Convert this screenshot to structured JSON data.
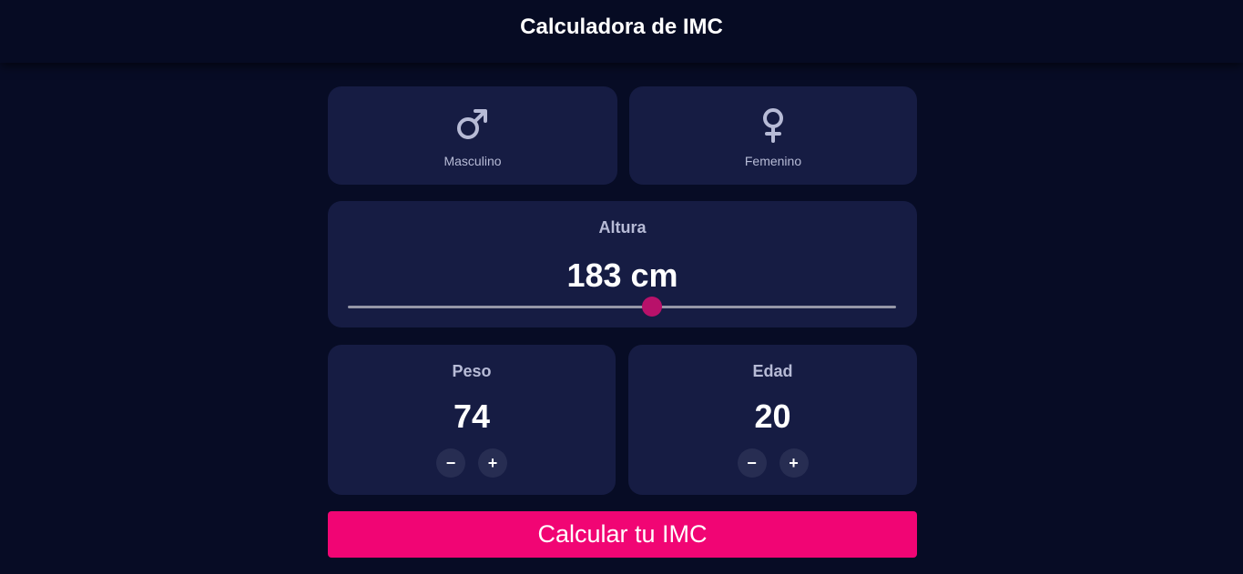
{
  "header": {
    "title": "Calculadora de IMC"
  },
  "gender": {
    "male": {
      "label": "Masculino",
      "icon": "male-symbol-icon"
    },
    "female": {
      "label": "Femenino",
      "icon": "female-symbol-icon"
    }
  },
  "height": {
    "label": "Altura",
    "value_text": "183 cm",
    "slider_fraction": 0.555
  },
  "weight": {
    "label": "Peso",
    "value": "74",
    "decrement": "−",
    "increment": "+"
  },
  "age": {
    "label": "Edad",
    "value": "20",
    "decrement": "−",
    "increment": "+"
  },
  "calculate": {
    "label": "Calcular tu IMC"
  },
  "colors": {
    "background": "#070c25",
    "card": "#161c43",
    "accent": "#f10574",
    "slider_thumb": "#b8116a",
    "icon": "#b7bbd6"
  }
}
